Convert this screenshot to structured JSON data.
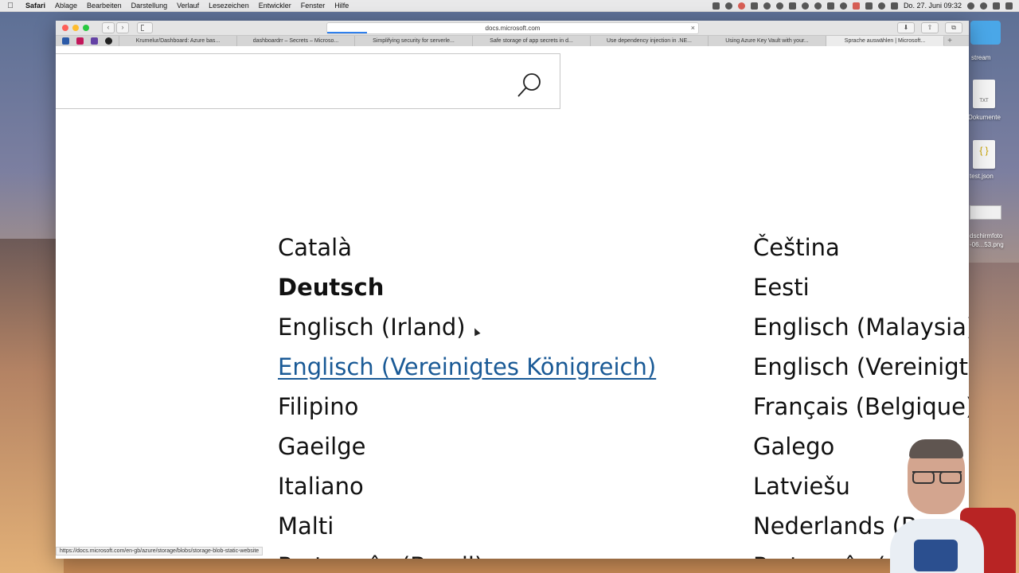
{
  "menubar": {
    "apple": "",
    "app_name": "Safari",
    "items": [
      "Ablage",
      "Bearbeiten",
      "Darstellung",
      "Verlauf",
      "Lesezeichen",
      "Entwickler",
      "Fenster",
      "Hilfe"
    ],
    "clock": "Do. 27. Juni  09:32"
  },
  "browser": {
    "address": "docs.microsoft.com",
    "tabs": [
      "Krumelur/Dashboard: Azure bas...",
      "dashboardrr – Secrets – Microso...",
      "Simplifying security for serverle...",
      "Safe storage of app secrets in d...",
      "Use dependency injection in .NE...",
      "Using Azure Key Vault with your...",
      "Sprache auswählen | Microsoft..."
    ],
    "status_url": "https://docs.microsoft.com/en-gb/azure/storage/blobs/storage-blob-static-website"
  },
  "page": {
    "search_placeholder": "",
    "languages_left": [
      "Català",
      "Deutsch",
      "Englisch (Irland)",
      "Englisch (Vereinigtes Königreich)",
      "Filipino",
      "Gaeilge",
      "Italiano",
      "Malti",
      "Português (Brasil)"
    ],
    "languages_right": [
      "Čeština",
      "Eesti",
      "Englisch (Malaysia)",
      "Englisch (Vereinigte",
      "Français (Belgique)",
      "Galego",
      "Latviešu",
      "Nederlands (B",
      "Português ("
    ]
  },
  "desktop": {
    "items": [
      "stream",
      "Dokumente",
      "test.json",
      "dschirmfoto",
      "-06...53.png"
    ],
    "doc_label": "TXT",
    "json_glyph": "{ }"
  },
  "colors": {
    "link": "#1a5a96",
    "progress": "#2f80ed"
  }
}
